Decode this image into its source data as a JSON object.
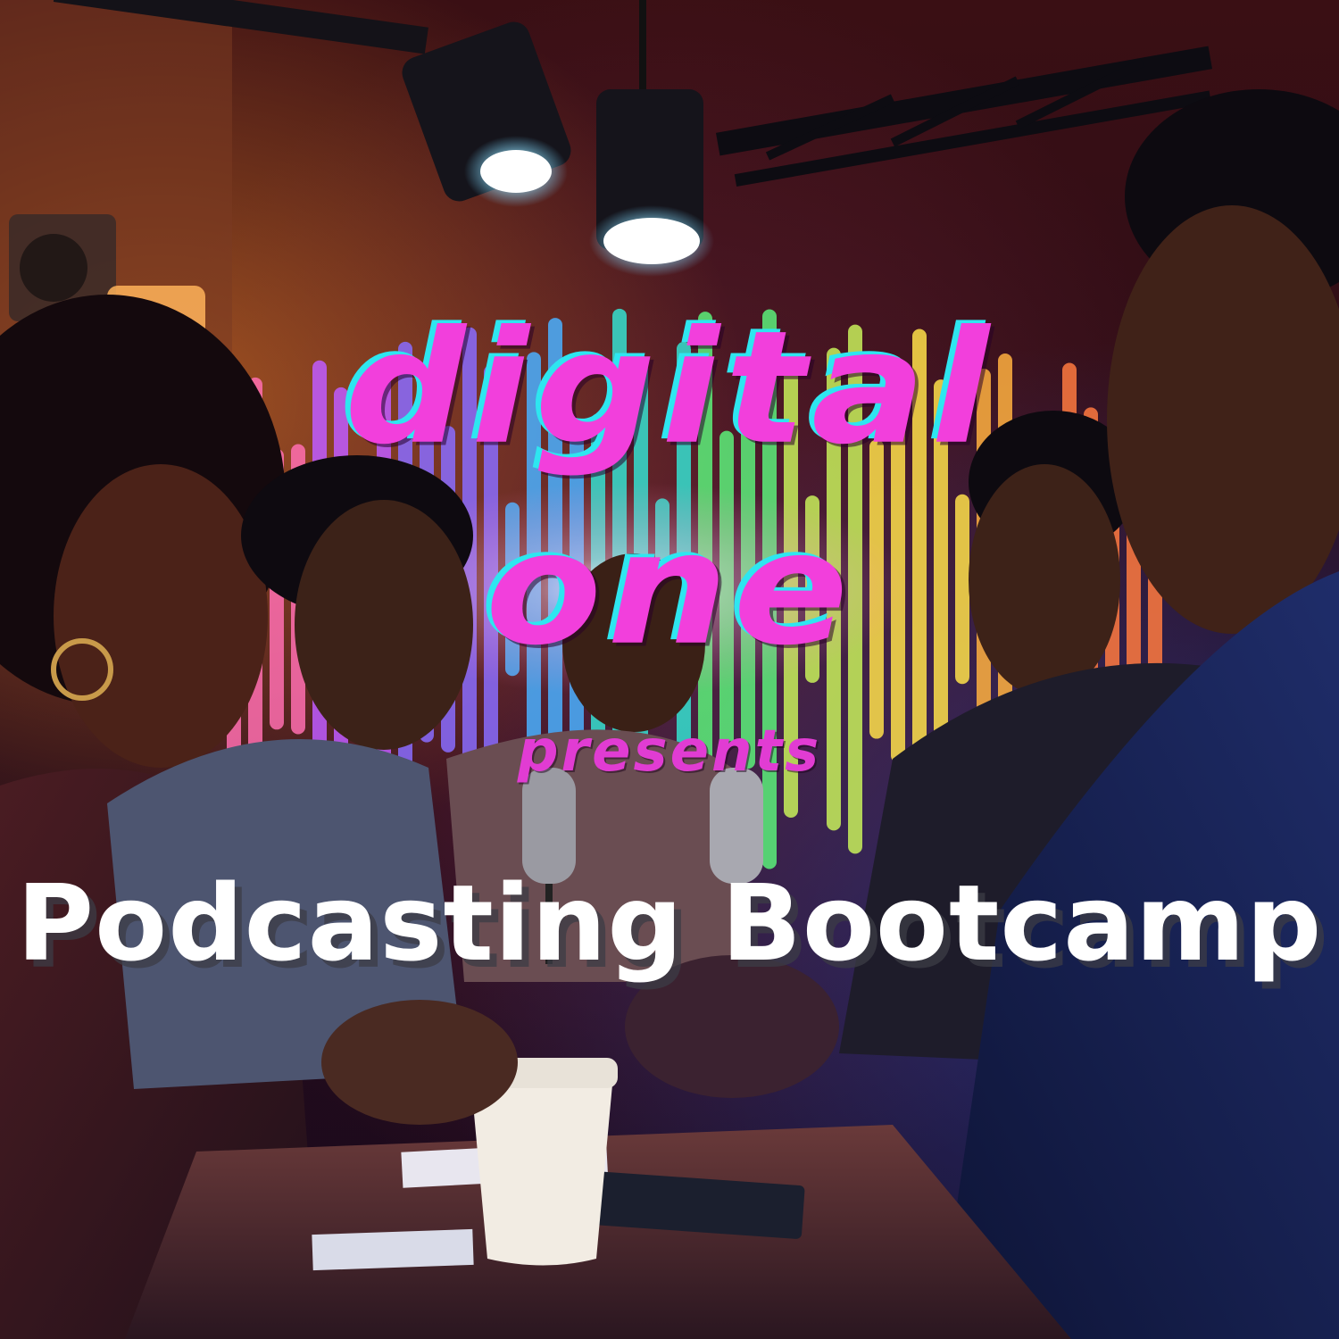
{
  "brand": {
    "line1": "digital",
    "line2": "one",
    "presents": "presents"
  },
  "event": {
    "title": "Podcasting Bootcamp"
  },
  "colors": {
    "brand_magenta": "#f23fdc",
    "brand_cyan_shadow": "#2ee6f0",
    "title_white": "#ffffff"
  },
  "scene": {
    "description_icons": [
      "studio-light-icon",
      "microphone-icon",
      "coffee-cup-icon",
      "sound-wave-bars"
    ]
  }
}
